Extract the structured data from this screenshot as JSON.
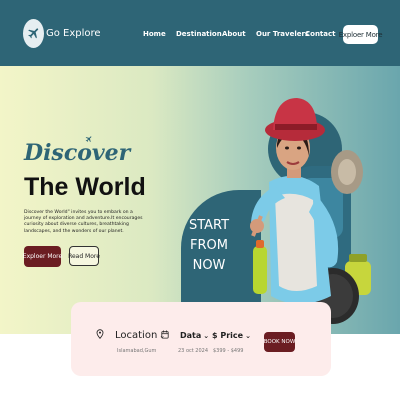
{
  "header": {
    "brand": "Go Explore",
    "nav": [
      "Home",
      "Destination",
      "About",
      "Our Travelers",
      "Contact"
    ],
    "cta": "Exploer More"
  },
  "hero": {
    "discover": "Discover",
    "title": "The World",
    "description": "Discover the World\" invites you to embark on a journey of exploration and adventure.It encourages curiosity about diverse cultures, breathtaking landscapes, and the wonders of our planet.",
    "primary_button": "Exploer More",
    "secondary_button": "Read More",
    "badge_lines": [
      "START",
      "FROM",
      "NOW"
    ]
  },
  "search": {
    "location_label": "Location",
    "location_value": "Islamabad,Gum",
    "date_label": "Data",
    "date_value": "23 oct 2024",
    "price_label": "$ Price",
    "price_value": "$399 - $499",
    "book_label": "BOOK NOW"
  },
  "colors": {
    "primary": "#2e6576",
    "accent": "#6b1d22",
    "card": "#fdeceb"
  }
}
